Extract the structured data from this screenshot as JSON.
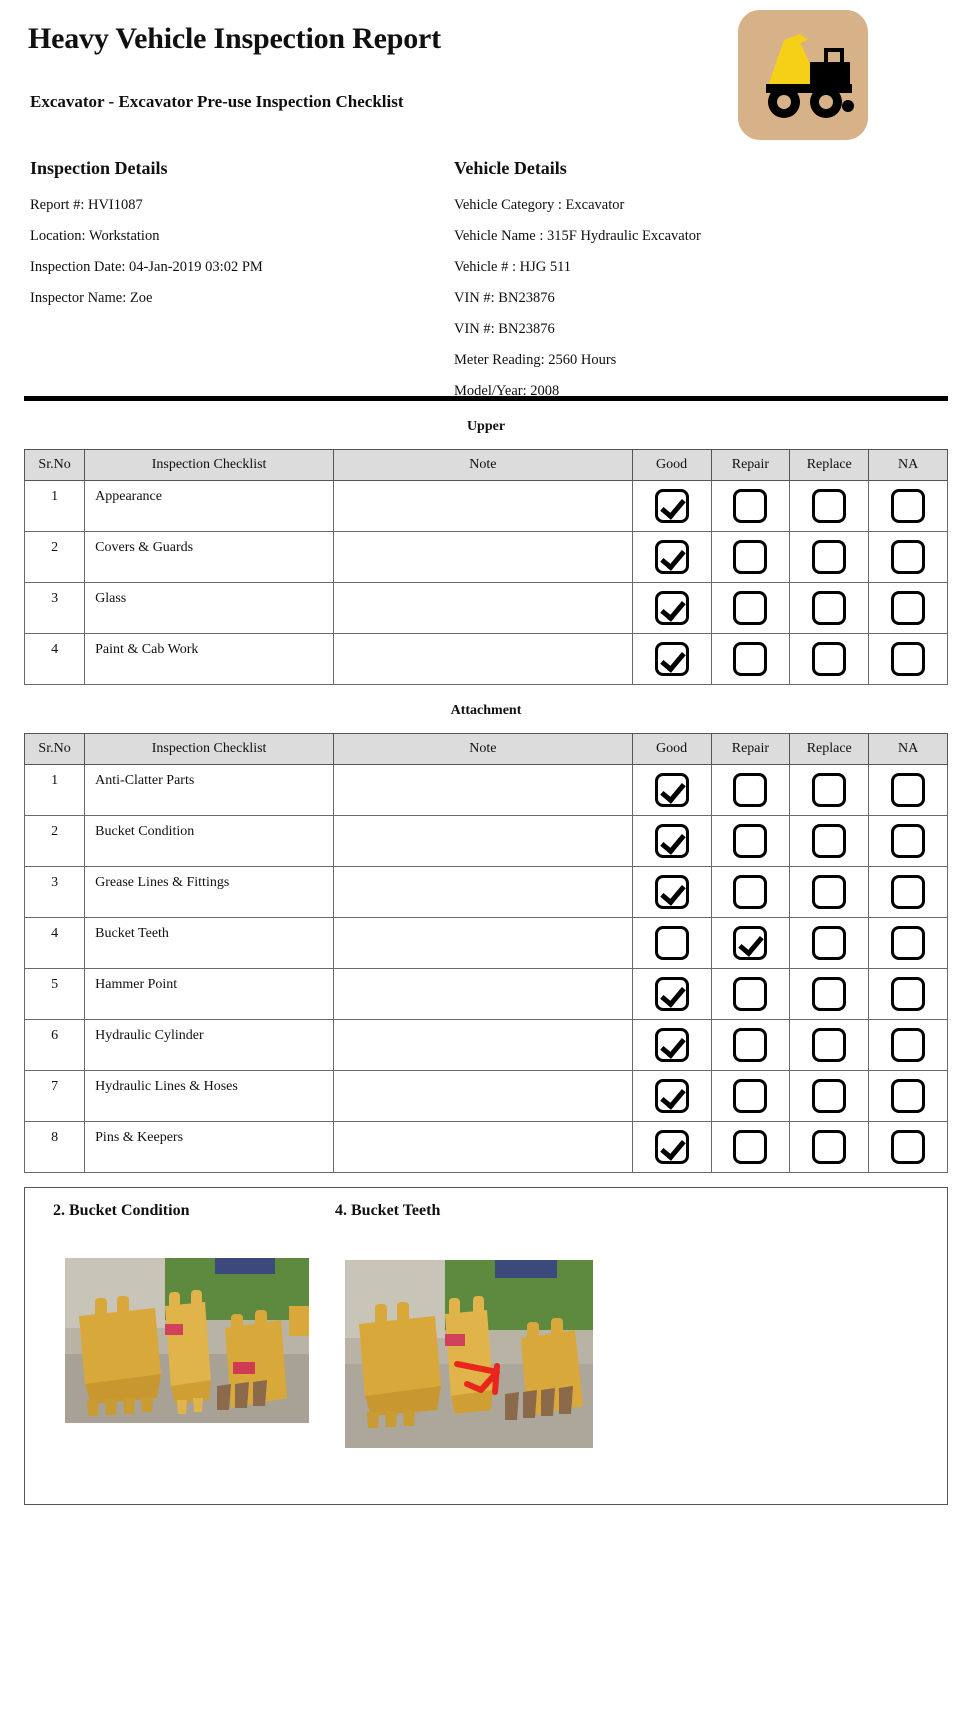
{
  "document": {
    "title": "Heavy Vehicle Inspection Report",
    "subtitle": "Excavator - Excavator Pre-use Inspection Checklist",
    "logo_icon": "dump-truck-icon"
  },
  "inspection_details": {
    "heading": "Inspection Details",
    "lines": [
      "Report #: HVI1087",
      "Location: Workstation",
      "Inspection Date: 04-Jan-2019 03:02 PM",
      "Inspector Name: Zoe"
    ]
  },
  "vehicle_details": {
    "heading": "Vehicle Details",
    "lines": [
      "Vehicle Category  : Excavator",
      "Vehicle Name : 315F Hydraulic Excavator",
      "Vehicle # : HJG 511",
      "VIN #: BN23876",
      "VIN #: BN23876",
      "Meter Reading: 2560 Hours",
      "Model/Year: 2008"
    ]
  },
  "columns": [
    "Sr.No",
    "Inspection Checklist",
    "Note",
    "Good",
    "Repair",
    "Replace",
    "NA"
  ],
  "sections": [
    {
      "title": "Upper",
      "rows": [
        {
          "sr": "1",
          "item": "Appearance",
          "note": "",
          "good": true,
          "repair": false,
          "replace": false,
          "na": false
        },
        {
          "sr": "2",
          "item": "Covers & Guards",
          "note": "",
          "good": true,
          "repair": false,
          "replace": false,
          "na": false
        },
        {
          "sr": "3",
          "item": "Glass",
          "note": "",
          "good": true,
          "repair": false,
          "replace": false,
          "na": false
        },
        {
          "sr": "4",
          "item": "Paint & Cab Work",
          "note": "",
          "good": true,
          "repair": false,
          "replace": false,
          "na": false
        }
      ]
    },
    {
      "title": "Attachment",
      "rows": [
        {
          "sr": "1",
          "item": "Anti-Clatter Parts",
          "note": "",
          "good": true,
          "repair": false,
          "replace": false,
          "na": false
        },
        {
          "sr": "2",
          "item": "Bucket Condition",
          "note": "",
          "good": true,
          "repair": false,
          "replace": false,
          "na": false
        },
        {
          "sr": "3",
          "item": "Grease Lines & Fittings",
          "note": "",
          "good": true,
          "repair": false,
          "replace": false,
          "na": false
        },
        {
          "sr": "4",
          "item": "Bucket Teeth",
          "note": "",
          "good": false,
          "repair": true,
          "replace": false,
          "na": false
        },
        {
          "sr": "5",
          "item": "Hammer Point",
          "note": "",
          "good": true,
          "repair": false,
          "replace": false,
          "na": false
        },
        {
          "sr": "6",
          "item": "Hydraulic Cylinder",
          "note": "",
          "good": true,
          "repair": false,
          "replace": false,
          "na": false
        },
        {
          "sr": "7",
          "item": "Hydraulic Lines & Hoses",
          "note": "",
          "good": true,
          "repair": false,
          "replace": false,
          "na": false
        },
        {
          "sr": "8",
          "item": "Pins & Keepers",
          "note": "",
          "good": true,
          "repair": false,
          "replace": false,
          "na": false
        }
      ]
    }
  ],
  "photos": [
    {
      "caption": "2. Bucket Condition",
      "alt": "excavator-buckets-photo",
      "annotated": false
    },
    {
      "caption": "4. Bucket Teeth",
      "alt": "excavator-bucket-teeth-photo",
      "annotated": true
    }
  ],
  "colors": {
    "logo_background": "#d7b188",
    "logo_bed": "#f5d016",
    "logo_body": "#000000",
    "annotation": "#e8261c",
    "header_fill": "#dcdcdc"
  }
}
